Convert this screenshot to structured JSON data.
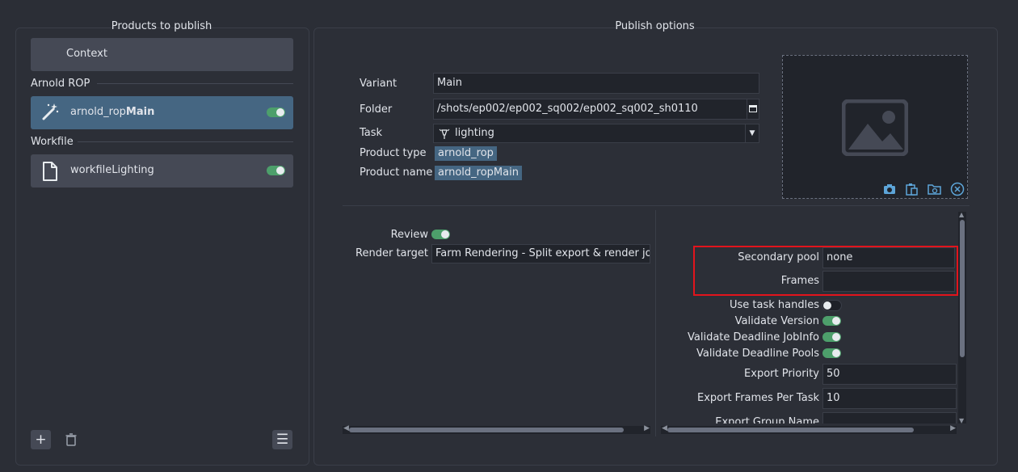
{
  "left_panel": {
    "title": "Products to publish",
    "context_label": "Context",
    "groups": [
      {
        "label": "Arnold ROP",
        "items": [
          {
            "prefix": "arnold_rop",
            "suffix": "Main",
            "enabled": true,
            "icon": "magic-wand-icon"
          }
        ]
      },
      {
        "label": "Workfile",
        "items": [
          {
            "prefix": "workfileLighting",
            "suffix": "",
            "enabled": true,
            "icon": "file-icon"
          }
        ]
      }
    ],
    "add_glyph": "+",
    "delete_glyph": "🗑",
    "menu_glyph": "☰"
  },
  "right_panel": {
    "title": "Publish options",
    "variant_label": "Variant",
    "variant_value": "Main",
    "folder_label": "Folder",
    "folder_value": "/shots/ep002/ep002_sq002/ep002_sq002_sh0110",
    "task_label": "Task",
    "task_value": "lighting",
    "product_type_label": "Product type",
    "product_type_value": "arnold_rop",
    "product_name_label": "Product name",
    "product_name_value": "arnold_ropMain",
    "review_label": "Review",
    "render_target_label": "Render target",
    "render_target_value": "Farm Rendering - Split export & render job",
    "secondary_pool_label": "Secondary pool",
    "secondary_pool_value": "none",
    "frames_label": "Frames",
    "frames_value": "",
    "use_task_handles_label": "Use task handles",
    "validate_version_label": "Validate Version",
    "validate_jobinfo_label": "Validate Deadline JobInfo",
    "validate_pools_label": "Validate Deadline Pools",
    "export_priority_label": "Export Priority",
    "export_priority_value": "50",
    "export_frames_label": "Export Frames Per Task",
    "export_frames_value": "10",
    "export_group_label": "Export Group Name"
  },
  "colors": {
    "background": "#2b2e36",
    "selected_item": "#456682",
    "toggle_on": "#4d9f6b",
    "highlight_box": "#e2141c"
  }
}
